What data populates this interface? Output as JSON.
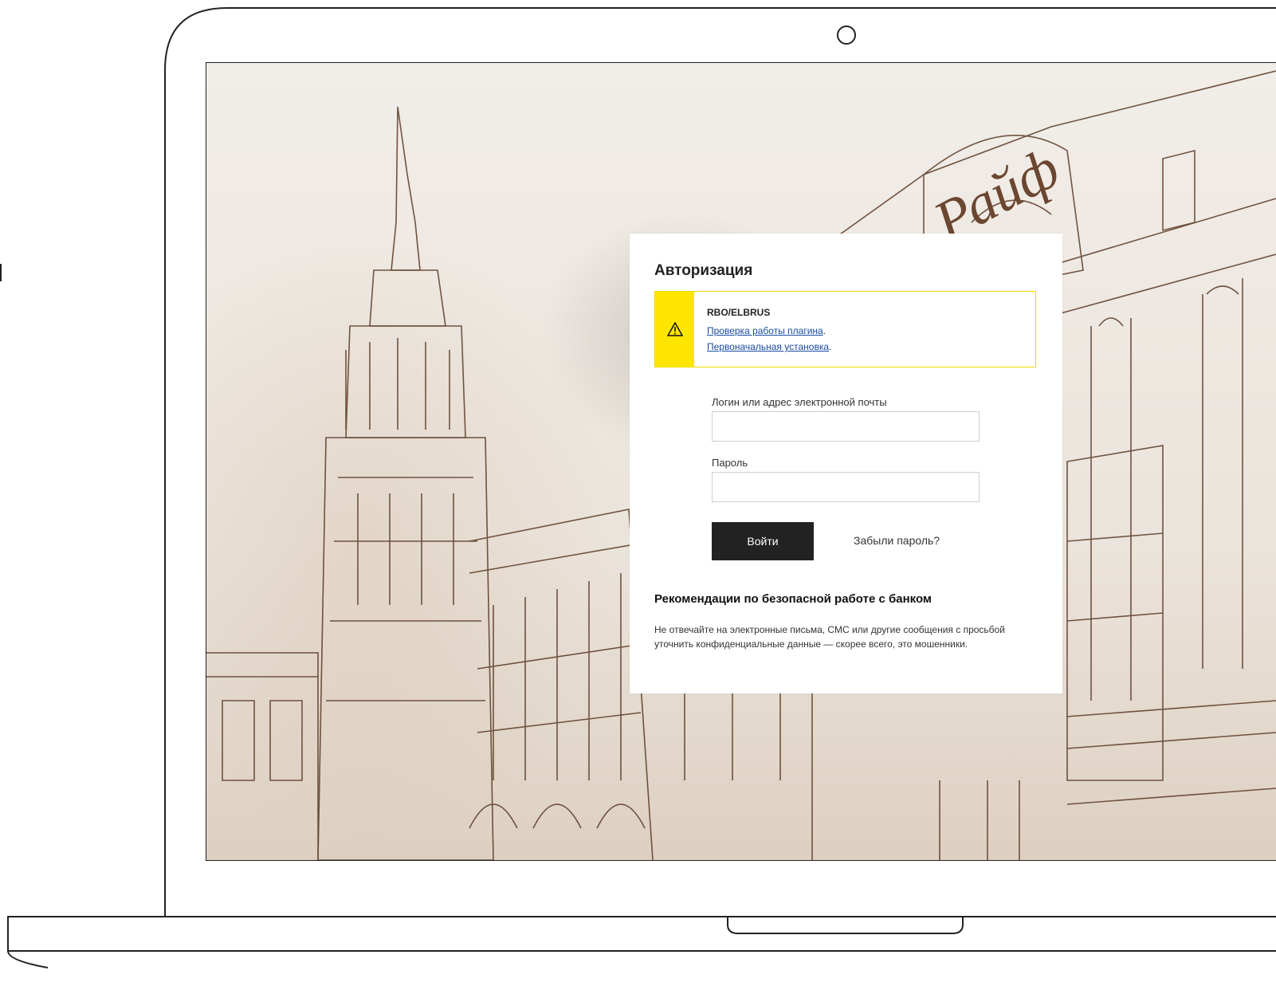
{
  "colors": {
    "accent_yellow": "#fee600",
    "notice_border": "#f2d600",
    "button_bg": "#222222",
    "link": "#1a4ca0"
  },
  "background": {
    "sign_text": "Райф"
  },
  "auth": {
    "title": "Авторизация",
    "notice": {
      "icon": "warning-icon",
      "title": "RBO/ELBRUS",
      "links": [
        {
          "text": "Проверка работы плагина",
          "suffix": "."
        },
        {
          "text": "Первоначальная установка",
          "suffix": "."
        }
      ]
    },
    "login_label": "Логин или адрес электронной почты",
    "login_value": "",
    "password_label": "Пароль",
    "password_value": "",
    "submit_label": "Войти",
    "forgot_label": "Забыли пароль?"
  },
  "recommendations": {
    "title": "Рекомендации по безопасной работе с банком",
    "text": "Не отвечайте на электронные письма, СМС или другие сообщения с просьбой уточнить конфиденциальные данные — скорее всего, это мошенники."
  }
}
